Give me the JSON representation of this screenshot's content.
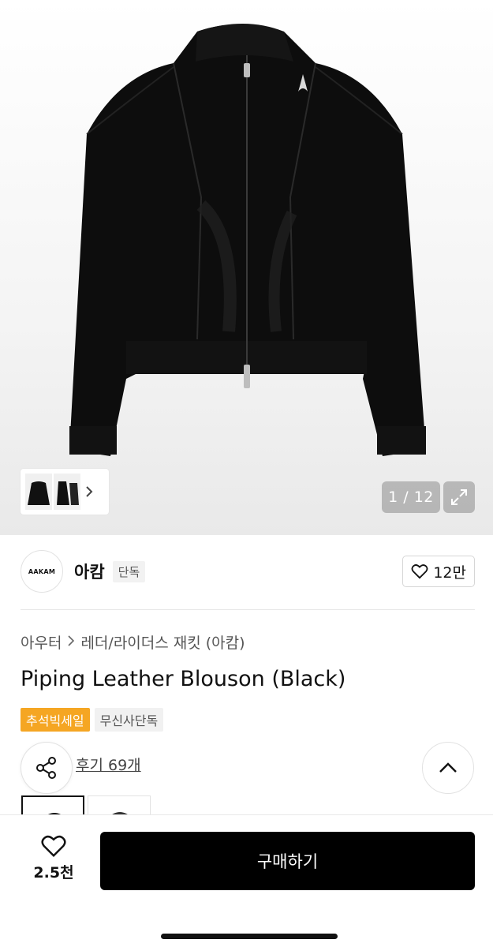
{
  "hero": {
    "counter": "1 / 12",
    "icons": {
      "thumb_next": "chevron-right-icon",
      "expand": "expand-icon"
    }
  },
  "brand": {
    "logo_text": "AAKAM",
    "name": "아캄",
    "badge": "단독",
    "like_count": "12만",
    "like_icon": "heart-outline-icon"
  },
  "breadcrumb": {
    "category": "아우터",
    "subcategory": "레더/라이더스 재킷 (아캄)"
  },
  "product": {
    "title": "Piping Leather Blouson (Black)",
    "tags": {
      "sale": "추석빅세일",
      "exclusive": "무신사단독"
    },
    "reviews": "후기 69개"
  },
  "bottom_bar": {
    "wish_count": "2.5천",
    "buy_label": "구매하기"
  },
  "colors": {
    "sale_tag": "#f5a623",
    "buy_button": "#000000",
    "jacket": "#0c0c0c"
  }
}
